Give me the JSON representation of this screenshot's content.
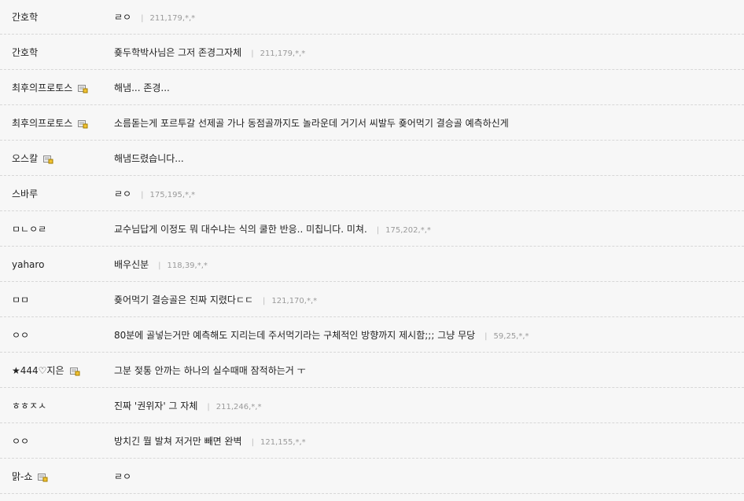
{
  "comments": [
    {
      "nick": "간호학",
      "badge": false,
      "text": "ㄹㅇ",
      "ip": "211,179,*,*"
    },
    {
      "nick": "간호학",
      "badge": false,
      "text": "죶두학박사님은 그저 존경그자체",
      "ip": "211,179,*,*"
    },
    {
      "nick": "최후의프로토스",
      "badge": true,
      "text": "해냄... 존경...",
      "ip": ""
    },
    {
      "nick": "최후의프로토스",
      "badge": true,
      "text": "소름돋는게 포르투갈 선제골 가나 동점골까지도 놀라운데 거기서 씨발두 죶어먹기 결승골 예측하신게",
      "ip": ""
    },
    {
      "nick": "오스칼",
      "badge": true,
      "text": "해냄드렸습니다...",
      "ip": ""
    },
    {
      "nick": "스바루",
      "badge": false,
      "text": "ㄹㅇ",
      "ip": "175,195,*,*"
    },
    {
      "nick": "ㅁㄴㅇㄹ",
      "badge": false,
      "text": "교수님답게 이정도 뭐 대수냐는 식의 쿨한 반응.. 미칩니다. 미쳐.",
      "ip": "175,202,*,*"
    },
    {
      "nick": "yaharo",
      "badge": false,
      "text": "배우신분",
      "ip": "118,39,*,*"
    },
    {
      "nick": "ㅁㅁ",
      "badge": false,
      "text": "죶어먹기 결승골은 진짜 지렸다ㄷㄷ",
      "ip": "121,170,*,*"
    },
    {
      "nick": "ㅇㅇ",
      "badge": false,
      "text": "80분에 골넣는거만 예측해도 지리는데 주서먹기라는 구체적인 방향까지 제시함;;; 그냥 무당",
      "ip": "59,25,*,*"
    },
    {
      "nick": "★444♡지은",
      "badge": true,
      "text": "그분 젖통 안까는 하나의 실수때매 잠적하는거 ㅜ",
      "ip": ""
    },
    {
      "nick": "ㅎㅎㅈㅅ",
      "badge": false,
      "text": "진짜 '권위자' 그 자체",
      "ip": "211,246,*,*"
    },
    {
      "nick": "ㅇㅇ",
      "badge": false,
      "text": "방치긴 뭘 발쳐 저거만 빼면 완벽",
      "ip": "121,155,*,*"
    },
    {
      "nick": "맑-쇼",
      "badge": true,
      "text": "ㄹㅇ",
      "ip": ""
    }
  ]
}
